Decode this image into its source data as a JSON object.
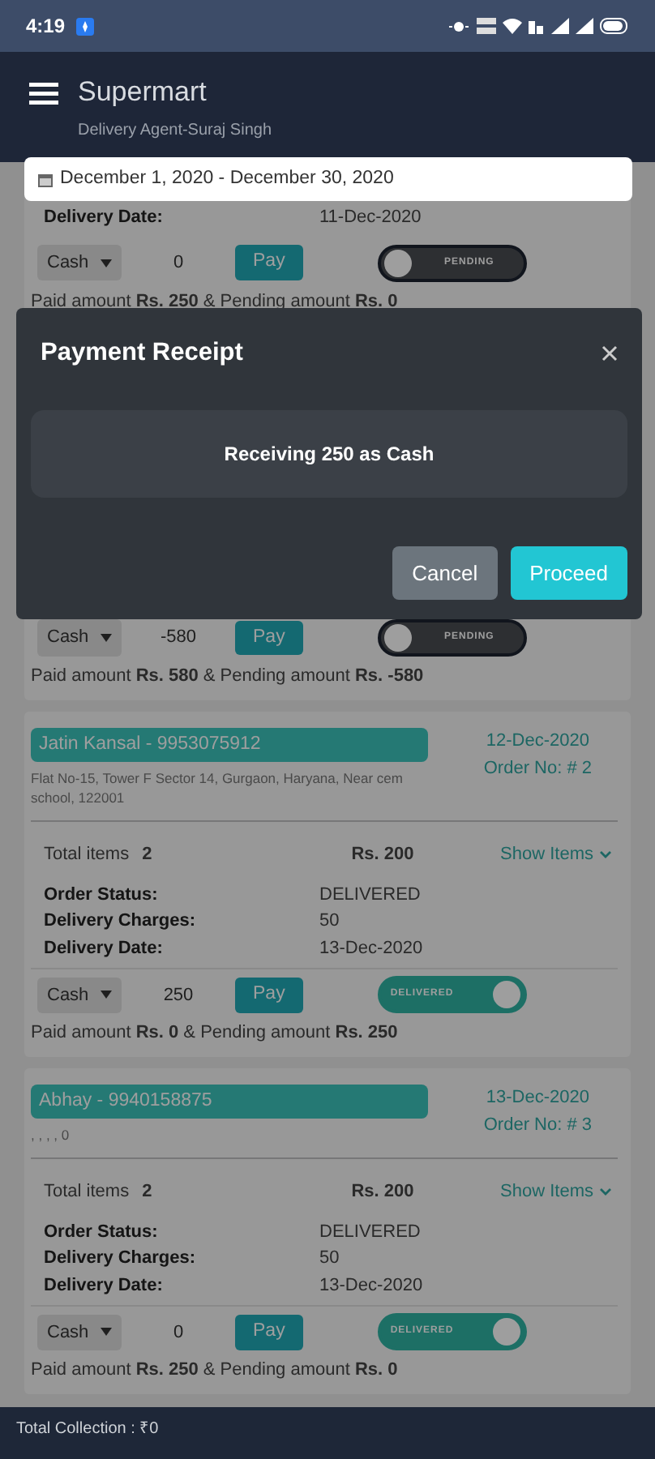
{
  "status_bar": {
    "time": "4:19"
  },
  "app_bar": {
    "title": "Supermart",
    "subtitle": "Delivery Agent-Suraj Singh"
  },
  "date_range": "December 1, 2020 - December 30, 2020",
  "orders": [
    {
      "details": [
        {
          "label": "Delivery Date:",
          "value": "11-Dec-2020"
        }
      ],
      "payment": {
        "method": "Cash",
        "amount": "0",
        "button": "Pay"
      },
      "status_toggle": {
        "label": "PENDING",
        "on": false
      },
      "summary": "Paid amount **Rs. 250**  & Pending amount **Rs. 0**"
    },
    {
      "payment": {
        "method": "Cash",
        "amount": "-580",
        "button": "Pay"
      },
      "status_toggle": {
        "label": "PENDING",
        "on": false
      },
      "summary": "Paid amount **Rs. 580**  & Pending amount **Rs. -580**"
    },
    {
      "customer": "Jatin Kansal - 9953075912",
      "address": "Flat No-15, Tower F Sector 14, Gurgaon, Haryana, Near cem school, 122001",
      "date": "12-Dec-2020",
      "order_no": "Order No: # 2",
      "total_items_label": "Total items",
      "total_items": "2",
      "amount": "Rs. 200",
      "show_items": "Show Items",
      "details": [
        {
          "label": "Order Status:",
          "value": "DELIVERED"
        },
        {
          "label": "Delivery Charges:",
          "value": "50"
        },
        {
          "label": "Delivery Date:",
          "value": "13-Dec-2020"
        }
      ],
      "payment": {
        "method": "Cash",
        "amount": "250",
        "button": "Pay"
      },
      "status_toggle": {
        "label": "DELIVERED",
        "on": true
      },
      "summary": "Paid amount **Rs. 0**  & Pending amount **Rs. 250**"
    },
    {
      "customer": "Abhay - 9940158875",
      "address": ", , , , 0",
      "date": "13-Dec-2020",
      "order_no": "Order No: # 3",
      "total_items_label": "Total items",
      "total_items": "2",
      "amount": "Rs. 200",
      "show_items": "Show Items",
      "details": [
        {
          "label": "Order Status:",
          "value": "DELIVERED"
        },
        {
          "label": "Delivery Charges:",
          "value": "50"
        },
        {
          "label": "Delivery Date:",
          "value": "13-Dec-2020"
        }
      ],
      "payment": {
        "method": "Cash",
        "amount": "0",
        "button": "Pay"
      },
      "status_toggle": {
        "label": "DELIVERED",
        "on": true
      },
      "summary": "Paid amount **Rs. 250**  & Pending amount **Rs. 0**"
    }
  ],
  "modal": {
    "title": "Payment Receipt",
    "message": "Receiving 250 as Cash",
    "buttons": [
      {
        "label": "Cancel",
        "kind": "secondary"
      },
      {
        "label": "Proceed",
        "kind": "primary"
      }
    ]
  },
  "footer": {
    "total": "Total Collection : ₹0"
  }
}
